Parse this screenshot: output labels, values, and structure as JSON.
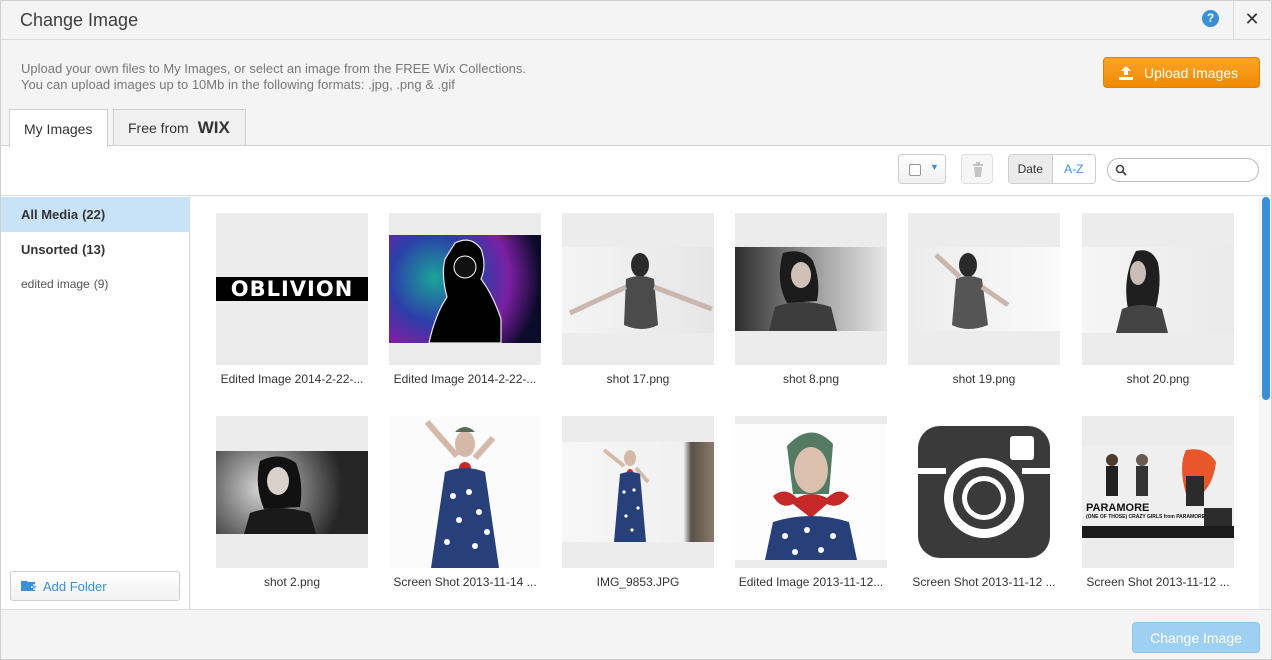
{
  "dialog": {
    "title": "Change Image",
    "help_label": "?",
    "close_label": "✕",
    "intro_line1": "Upload your own files to My Images, or select an image from the FREE Wix Collections.",
    "intro_line2": "You can upload images up to 10Mb in the following formats: .jpg, .png & .gif",
    "upload_label": "Upload Images",
    "accent": "#3b8fd6",
    "upload_color": "#f39200"
  },
  "tabs": {
    "my_images": "My Images",
    "free_from": "Free from",
    "wix": "WIX"
  },
  "toolbar": {
    "sort_date": "Date",
    "sort_az": "A-Z",
    "search_placeholder": ""
  },
  "sidebar": {
    "folders": [
      {
        "label": "All Media",
        "count": "(22)"
      },
      {
        "label": "Unsorted",
        "count": "(13)"
      },
      {
        "label": "edited image",
        "count": "(9)"
      }
    ],
    "add_folder": "Add Folder"
  },
  "images": [
    {
      "name": "Edited Image 2014-2-22-..."
    },
    {
      "name": "Edited Image 2014-2-22-..."
    },
    {
      "name": "shot 17.png"
    },
    {
      "name": "shot 8.png"
    },
    {
      "name": "shot 19.png"
    },
    {
      "name": "shot 20.png"
    },
    {
      "name": "shot 2.png"
    },
    {
      "name": "Screen Shot 2013-11-14 ..."
    },
    {
      "name": "IMG_9853.JPG"
    },
    {
      "name": "Edited Image 2013-11-12..."
    },
    {
      "name": "Screen Shot 2013-11-12 ..."
    },
    {
      "name": "Screen Shot 2013-11-12 ..."
    }
  ],
  "thumb_text": {
    "oblivion": "OBLIVION",
    "paramore": "PARAMORE",
    "paramore_sub": "(ONE OF THOSE) CRAZY GIRLS from PARAMORE"
  },
  "footer": {
    "change_label": "Change Image"
  }
}
